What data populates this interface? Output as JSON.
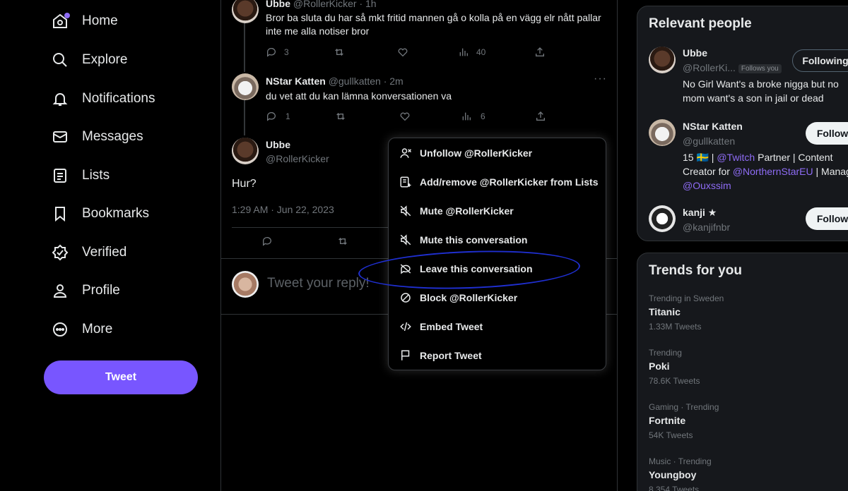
{
  "nav": {
    "items": [
      {
        "label": "Home",
        "icon": "home-icon"
      },
      {
        "label": "Explore",
        "icon": "search-icon"
      },
      {
        "label": "Notifications",
        "icon": "bell-icon"
      },
      {
        "label": "Messages",
        "icon": "envelope-icon"
      },
      {
        "label": "Lists",
        "icon": "list-icon"
      },
      {
        "label": "Bookmarks",
        "icon": "bookmark-icon"
      },
      {
        "label": "Verified",
        "icon": "verified-icon"
      },
      {
        "label": "Profile",
        "icon": "person-icon"
      },
      {
        "label": "More",
        "icon": "more-circle-icon"
      }
    ],
    "tweet_button": "Tweet"
  },
  "thread": {
    "tweets": [
      {
        "name": "Ubbe",
        "handle": "@RollerKicker · 1h",
        "text_line1": "Bror ba sluta du har så mkt fritid mannen gå o kolla på en vägg elr nått pallar",
        "text_line2": "inte me alla notiser bror",
        "replies": "3",
        "retweets": "",
        "likes": "",
        "views": "40"
      },
      {
        "name": "NStar Katten",
        "handle": "@gullkatten · 2m",
        "text_line1": "du vet att du kan lämna konversationen va",
        "replies": "1",
        "retweets": "",
        "likes": "",
        "views": "6"
      }
    ],
    "focused": {
      "name": "Ubbe",
      "handle": "@RollerKicker",
      "text": "Hur?",
      "timestamp": "1:29 AM · Jun 22, 2023"
    },
    "reply_placeholder": "Tweet your reply!"
  },
  "menu": {
    "items": [
      {
        "label": "Unfollow @RollerKicker",
        "icon": "unfollow-icon"
      },
      {
        "label": "Add/remove @RollerKicker from Lists",
        "icon": "list-add-icon"
      },
      {
        "label": "Mute @RollerKicker",
        "icon": "mute-icon"
      },
      {
        "label": "Mute this conversation",
        "icon": "mute-conversation-icon"
      },
      {
        "label": "Leave this conversation",
        "icon": "leave-conversation-icon"
      },
      {
        "label": "Block @RollerKicker",
        "icon": "block-icon"
      },
      {
        "label": "Embed Tweet",
        "icon": "code-icon"
      },
      {
        "label": "Report Tweet",
        "icon": "flag-icon"
      }
    ]
  },
  "relevant_people": {
    "title": "Relevant people",
    "people": [
      {
        "name": "Ubbe",
        "handle": "@RollerKi...",
        "badge": "Follows you",
        "bio_line1": "No Girl Want's a broke nigga but no",
        "bio_line2": "mom want's a son in jail or dead",
        "button": "Following"
      },
      {
        "name": "NStar Katten",
        "handle": "@gullkatten",
        "bio_l1_a": "15 ",
        "bio_l1_flag": "🇸🇪",
        "bio_l1_b": " | ",
        "bio_l1_link": "@Twitch",
        "bio_l1_c": " Partner | Content",
        "bio_l2_a": "Creator for ",
        "bio_l2_link": "@NorthernStarEU",
        "bio_l2_b": " | Manag",
        "bio_l3_link": "@Ouxssim",
        "button": "Follow"
      },
      {
        "name": "kanji ★",
        "handle": "@kanjifnbr",
        "button": "Follow"
      }
    ]
  },
  "trends": {
    "title": "Trends for you",
    "items": [
      {
        "context": "Trending in Sweden",
        "name": "Titanic",
        "count": "1.33M Tweets"
      },
      {
        "context": "Trending",
        "name": "Poki",
        "count": "78.6K Tweets"
      },
      {
        "context": "Gaming · Trending",
        "name": "Fortnite",
        "count": "54K Tweets"
      },
      {
        "context": "Music · Trending",
        "name": "Youngboy",
        "count": "8,354 Tweets"
      }
    ]
  },
  "colors": {
    "accent": "#7856ff",
    "link": "#8e6cf5",
    "annotation": "#1f2fd1"
  }
}
